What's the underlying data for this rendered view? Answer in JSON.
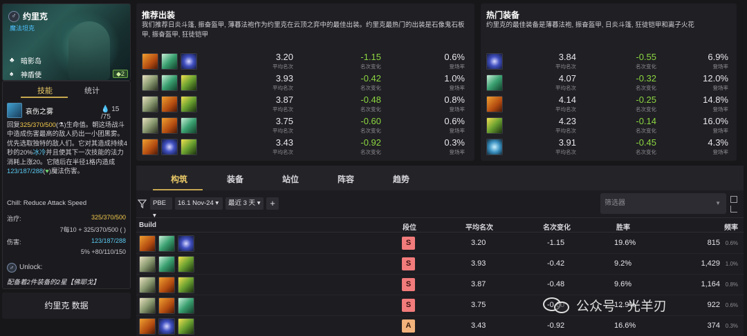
{
  "champion": {
    "name": "约里克",
    "class": "魔法坦克",
    "traits": [
      "暗影岛",
      "神盾使"
    ],
    "cost": "2"
  },
  "left_tabs": [
    "技能",
    "统计"
  ],
  "skill": {
    "name": "哀伤之雾",
    "mana": "15 /75",
    "desc_1": "回复",
    "heal_values": "325/370/500",
    "desc_2": "生命值。朝这场战斗中造成伤害最高的敌人扔出一小团黑雾。优先选取独特的敌人们。它对其造成持续4秒的20%",
    "chill_word": "冰冷",
    "desc_3": "并且使其下一次技能的法力消耗上涨20。它随后在半径1格内造成",
    "dmg_values": "123/187/288",
    "desc_4": "魔法伤害。",
    "chill_label": "Chill: Reduce Attack Speed",
    "heal_label": "治疗:",
    "heal_val": "325/370/500",
    "heal_formula": "7每10 + 325/370/500 (  )",
    "dmg_label": "伤害:",
    "dmg_val": "123/187/288",
    "dmg_formula": "5%  +80/110/150",
    "unlock_label": "Unlock:",
    "unlock_text": "配备着2件装备的2星【佛耶戈】"
  },
  "champ_data_btn": "约里克 数据",
  "recommended": {
    "title": "推荐出装",
    "desc": "我们推荐日炎斗篷, 振奋盔甲, 薄暮法袍作为约里克在云顶之弈中的最佳出装。约里克最热门的出装是石像鬼石板甲, 振奋盔甲, 狂徒铠甲",
    "rows": [
      {
        "icons": [
          "ic-a",
          "ic-b",
          "ic-c"
        ],
        "avg": "3.20",
        "avg_label": "平均名次",
        "delta": "-1.15",
        "delta_label": "名次变化",
        "freq": "0.6%",
        "freq_label": "登场率"
      },
      {
        "icons": [
          "ic-d",
          "ic-b",
          "ic-e"
        ],
        "avg": "3.93",
        "avg_label": "平均名次",
        "delta": "-0.42",
        "delta_label": "名次变化",
        "freq": "1.0%",
        "freq_label": "登场率"
      },
      {
        "icons": [
          "ic-d",
          "ic-a",
          "ic-e"
        ],
        "avg": "3.87",
        "avg_label": "平均名次",
        "delta": "-0.48",
        "delta_label": "名次变化",
        "freq": "0.8%",
        "freq_label": "登场率"
      },
      {
        "icons": [
          "ic-d",
          "ic-a",
          "ic-b"
        ],
        "avg": "3.75",
        "avg_label": "平均名次",
        "delta": "-0.60",
        "delta_label": "名次变化",
        "freq": "0.6%",
        "freq_label": "登场率"
      },
      {
        "icons": [
          "ic-a",
          "ic-c",
          "ic-e"
        ],
        "avg": "3.43",
        "avg_label": "平均名次",
        "delta": "-0.92",
        "delta_label": "名次变化",
        "freq": "0.3%",
        "freq_label": "登场率"
      }
    ]
  },
  "hot": {
    "title": "热门装备",
    "desc": "约里克的最佳装备是薄暮法袍, 振奋盔甲, 日炎斗篷, 狂徒铠甲和离子火花",
    "rows": [
      {
        "icon": "ic-c",
        "avg": "3.84",
        "avg_label": "平均名次",
        "delta": "-0.55",
        "delta_label": "名次变化",
        "freq": "6.9%",
        "freq_label": "登场率"
      },
      {
        "icon": "ic-b",
        "avg": "4.07",
        "avg_label": "平均名次",
        "delta": "-0.32",
        "delta_label": "名次变化",
        "freq": "12.0%",
        "freq_label": "登场率"
      },
      {
        "icon": "ic-a",
        "avg": "4.14",
        "avg_label": "平均名次",
        "delta": "-0.25",
        "delta_label": "名次变化",
        "freq": "14.8%",
        "freq_label": "登场率"
      },
      {
        "icon": "ic-e",
        "avg": "4.23",
        "avg_label": "平均名次",
        "delta": "-0.14",
        "delta_label": "名次变化",
        "freq": "16.0%",
        "freq_label": "登场率"
      },
      {
        "icon": "ic-f",
        "avg": "3.91",
        "avg_label": "平均名次",
        "delta": "-0.45",
        "delta_label": "名次变化",
        "freq": "4.3%",
        "freq_label": "登场率"
      }
    ]
  },
  "main_tabs": [
    "构筑",
    "装备",
    "站位",
    "阵容",
    "趋势"
  ],
  "filters": {
    "chips": [
      "PBE ▾",
      "16.1 Nov-24 ▾",
      "最近 3 天 ▾"
    ],
    "add": "+",
    "select_placeholder": "筛选器"
  },
  "table": {
    "headers": [
      "Build",
      "段位",
      "平均名次",
      "名次变化",
      "胜率",
      "频率"
    ],
    "rows": [
      {
        "icons": [
          "ic-a",
          "ic-b",
          "ic-c"
        ],
        "tier": "S",
        "avg": "3.20",
        "delta": "-1.15",
        "win": "19.6%",
        "count": "815",
        "pct": "0.6%"
      },
      {
        "icons": [
          "ic-d",
          "ic-b",
          "ic-e"
        ],
        "tier": "S",
        "avg": "3.93",
        "delta": "-0.42",
        "win": "9.2%",
        "count": "1,429",
        "pct": "1.0%"
      },
      {
        "icons": [
          "ic-d",
          "ic-a",
          "ic-e"
        ],
        "tier": "S",
        "avg": "3.87",
        "delta": "-0.48",
        "win": "9.6%",
        "count": "1,164",
        "pct": "0.8%"
      },
      {
        "icons": [
          "ic-d",
          "ic-a",
          "ic-b"
        ],
        "tier": "S",
        "avg": "3.75",
        "delta": "-0.60",
        "win": "12.9%",
        "count": "922",
        "pct": "0.6%"
      },
      {
        "icons": [
          "ic-a",
          "ic-c",
          "ic-e"
        ],
        "tier": "A",
        "avg": "3.43",
        "delta": "-0.92",
        "win": "16.6%",
        "count": "374",
        "pct": "0.3%"
      }
    ]
  },
  "watermark": "公众号 · 光羊刃",
  "colors": {
    "accent_gold": "#c8a850",
    "positive_green": "#8dd640",
    "tier_s": "#f27b7b",
    "tier_a": "#f2b27b",
    "class_blue": "#4ec0ff"
  }
}
